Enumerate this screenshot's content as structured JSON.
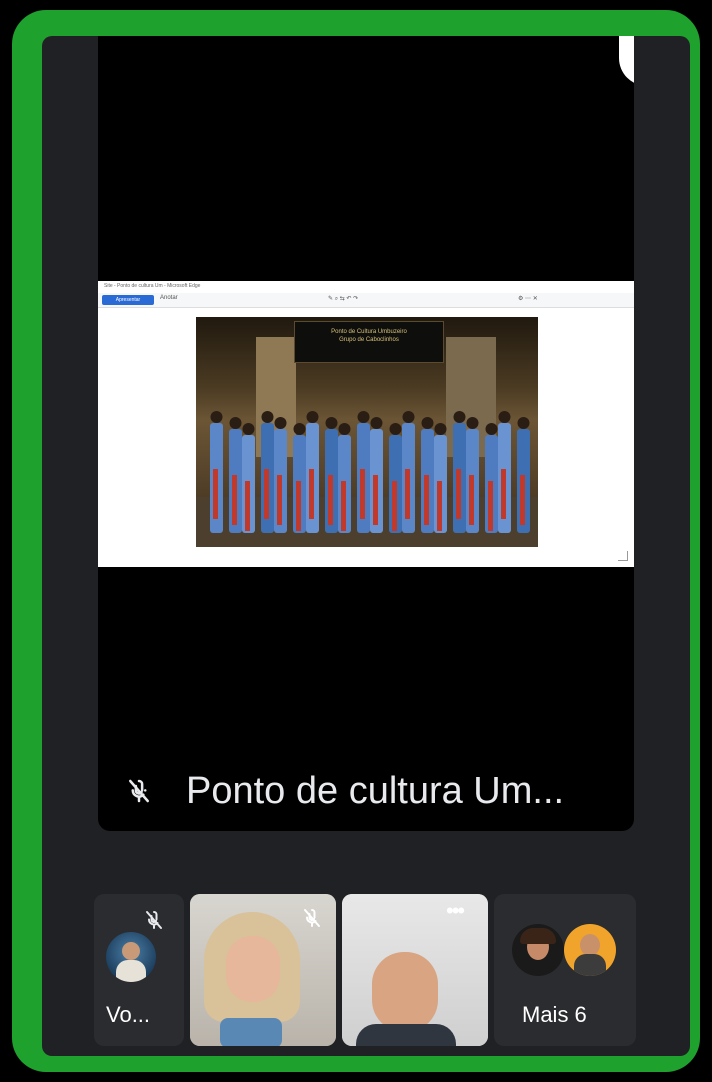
{
  "main": {
    "presenter_name": "Ponto de cultura Um...",
    "shared_window_title": "Site - Ponto de cultura Um - Microsoft Edge",
    "shared_toolbar_button": "Apresentar",
    "shared_toolbar_link": "Anotar",
    "banner_text": "Ponto de Cultura Umbuzeiro",
    "banner_subtext": "Grupo de Caboclinhos"
  },
  "participants": [
    {
      "label": "Vo..."
    },
    {
      "label": ""
    },
    {
      "label": ""
    },
    {
      "label": "Mais 6"
    }
  ],
  "colors": {
    "frame": "#1fa12e",
    "background": "#202124",
    "video_black": "#000000",
    "text": "#e8eaed"
  },
  "icons": {
    "pin": "pin-icon",
    "mic_off": "mic-off-icon",
    "more": "more-options-icon"
  }
}
